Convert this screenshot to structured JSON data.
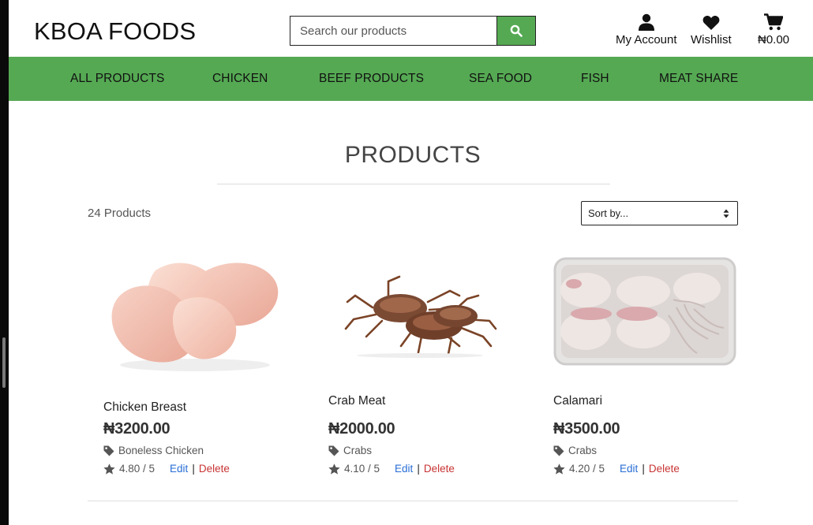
{
  "brand": "KBOA FOODS",
  "search": {
    "placeholder": "Search our products"
  },
  "header_links": {
    "account": "My Account",
    "wishlist": "Wishlist",
    "cart_total": "₦0.00"
  },
  "nav": [
    "ALL PRODUCTS",
    "CHICKEN",
    "BEEF PRODUCTS",
    "SEA FOOD",
    "FISH",
    "MEAT SHARE"
  ],
  "page_title": "PRODUCTS",
  "product_count": "24 Products",
  "sort": {
    "selected": "Sort by..."
  },
  "products": [
    {
      "name": "Chicken Breast",
      "price": "₦3200.00",
      "category": "Boneless Chicken",
      "rating": "4.80 / 5",
      "edit": "Edit",
      "delete": "Delete"
    },
    {
      "name": "Crab Meat",
      "price": "₦2000.00",
      "category": "Crabs",
      "rating": "4.10 / 5",
      "edit": "Edit",
      "delete": "Delete"
    },
    {
      "name": "Calamari",
      "price": "₦3500.00",
      "category": "Crabs",
      "rating": "4.20 / 5",
      "edit": "Edit",
      "delete": "Delete"
    }
  ],
  "colors": {
    "nav_green": "#55a953",
    "edit_link": "#2a6fd6",
    "delete_link": "#c93434"
  },
  "icons": [
    "search-icon",
    "user-icon",
    "heart-icon",
    "cart-icon",
    "tag-icon",
    "star-icon",
    "sort-arrows-icon"
  ]
}
